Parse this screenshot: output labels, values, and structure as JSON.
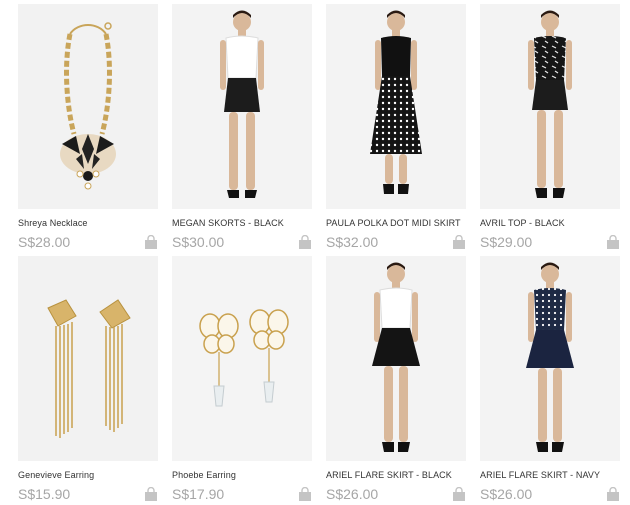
{
  "products": [
    {
      "name": "Shreya Necklace",
      "price": "S$28.00",
      "image": "necklace"
    },
    {
      "name": "MEGAN SKORTS - BLACK",
      "price": "S$30.00",
      "image": "model-white-top-black-skort"
    },
    {
      "name": "PAULA POLKA DOT MIDI SKIRT",
      "price": "S$32.00",
      "image": "model-black-top-polka-midi"
    },
    {
      "name": "AVRIL TOP - BLACK",
      "price": "S$29.00",
      "image": "model-print-top-black-skort"
    },
    {
      "name": "Genevieve Earring",
      "price": "S$15.90",
      "image": "gold-tassel-earrings"
    },
    {
      "name": "Phoebe Earring",
      "price": "S$17.90",
      "image": "butterfly-drop-earrings"
    },
    {
      "name": "ARIEL FLARE SKIRT - BLACK",
      "price": "S$26.00",
      "image": "model-white-top-black-flare"
    },
    {
      "name": "ARIEL FLARE SKIRT - NAVY",
      "price": "S$26.00",
      "image": "model-dot-top-navy-flare"
    }
  ],
  "icons": {
    "add_to_cart": "shopping-bag-icon"
  },
  "colors": {
    "price": "#a6a6a6",
    "name": "#333333",
    "thumb_bg": "#efefef",
    "bag_icon": "#c4c4c4"
  }
}
